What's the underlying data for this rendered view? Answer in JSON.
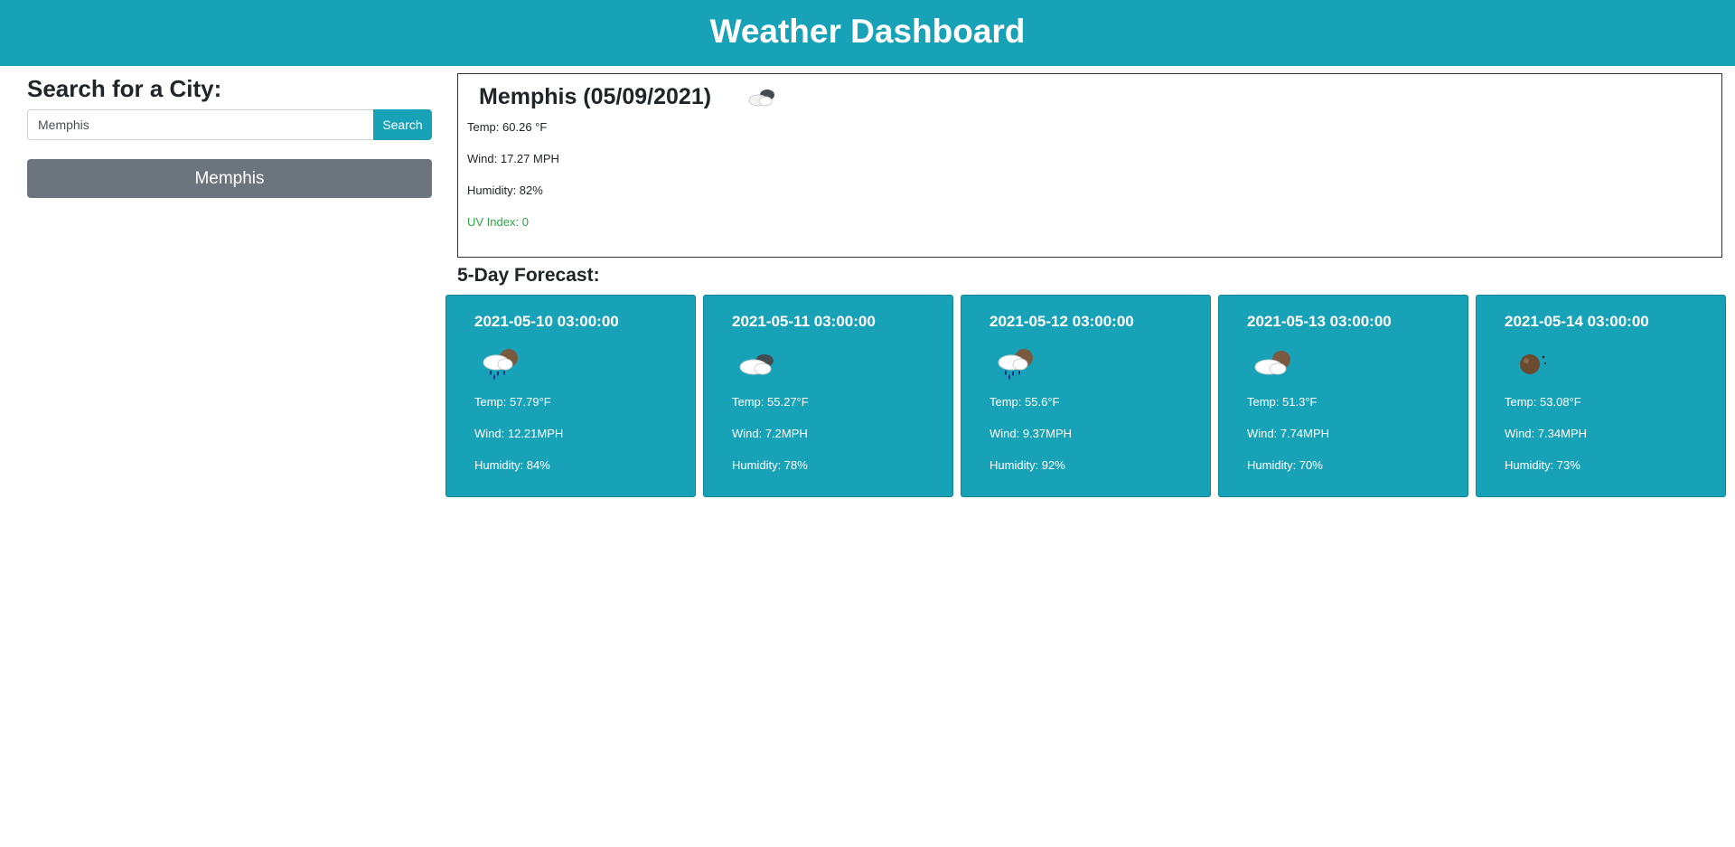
{
  "header": {
    "title": "Weather Dashboard"
  },
  "sidebar": {
    "title": "Search for a City:",
    "search": {
      "value": "Memphis",
      "button_label": "Search"
    },
    "history": [
      {
        "label": "Memphis"
      }
    ]
  },
  "current": {
    "title": "Memphis (05/09/2021)",
    "icon": "cloud-icon",
    "temp": "Temp: 60.26 °F",
    "wind": "Wind: 17.27 MPH",
    "humidity": "Humidity: 82%",
    "uv": "UV Index: 0",
    "uv_color": "#28a745"
  },
  "forecast": {
    "title": "5-Day Forecast:",
    "days": [
      {
        "date": "2021-05-10 03:00:00",
        "icon": "rain-cloud-icon",
        "temp": "Temp: 57.79°F",
        "wind": "Wind: 12.21MPH",
        "humidity": "Humidity: 84%"
      },
      {
        "date": "2021-05-11 03:00:00",
        "icon": "cloud-icon",
        "temp": "Temp: 55.27°F",
        "wind": "Wind: 7.2MPH",
        "humidity": "Humidity: 78%"
      },
      {
        "date": "2021-05-12 03:00:00",
        "icon": "rain-cloud-icon",
        "temp": "Temp: 55.6°F",
        "wind": "Wind: 9.37MPH",
        "humidity": "Humidity: 92%"
      },
      {
        "date": "2021-05-13 03:00:00",
        "icon": "partly-cloudy-night-icon",
        "temp": "Temp: 51.3°F",
        "wind": "Wind: 7.74MPH",
        "humidity": "Humidity: 70%"
      },
      {
        "date": "2021-05-14 03:00:00",
        "icon": "clear-night-icon",
        "temp": "Temp: 53.08°F",
        "wind": "Wind: 7.34MPH",
        "humidity": "Humidity: 73%"
      }
    ]
  },
  "colors": {
    "accent": "#17a2b8",
    "history_button": "#6c757d"
  }
}
